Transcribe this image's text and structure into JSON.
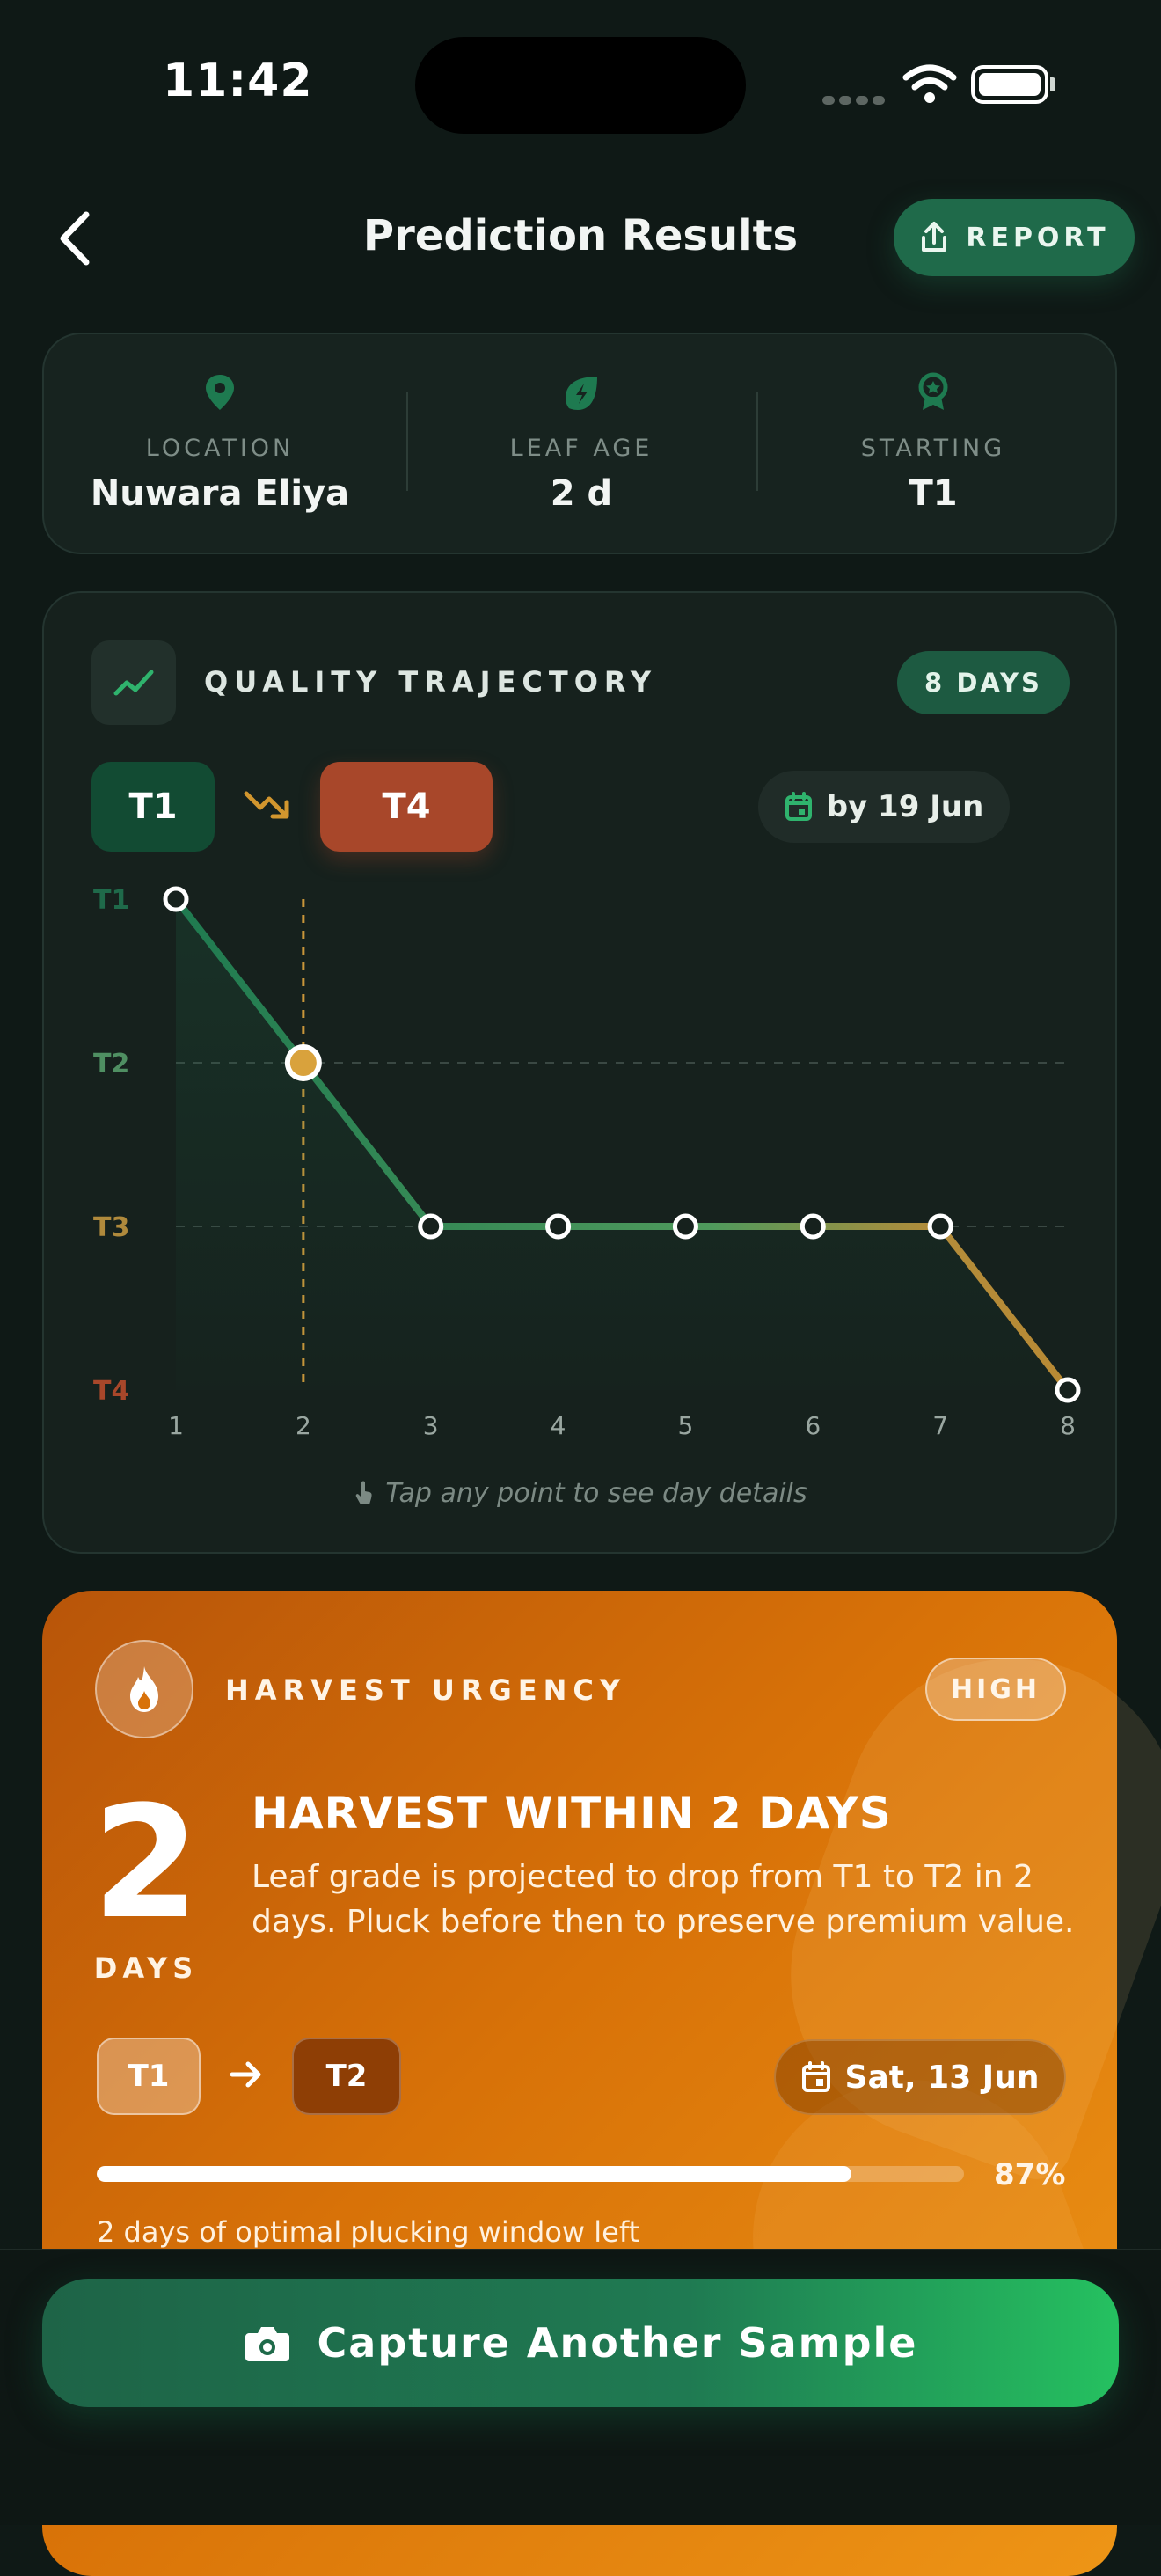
{
  "status_bar": {
    "time": "11:42"
  },
  "header": {
    "title": "Prediction Results",
    "report_label": "REPORT"
  },
  "info": [
    {
      "icon": "location-pin-icon",
      "label": "LOCATION",
      "value": "Nuwara Eliya"
    },
    {
      "icon": "leaf-bolt-icon",
      "label": "LEAF AGE",
      "value": "2 d"
    },
    {
      "icon": "award-badge-icon",
      "label": "STARTING",
      "value": "T1"
    }
  ],
  "trajectory": {
    "label": "QUALITY TRAJECTORY",
    "days_badge": "8 DAYS",
    "from_grade": "T1",
    "to_grade": "T4",
    "by_date": "by 19 Jun",
    "tap_hint": "Tap any point to see day details"
  },
  "chart_data": {
    "type": "line",
    "x": [
      1,
      2,
      3,
      4,
      5,
      6,
      7,
      8
    ],
    "y_categories": [
      "T1",
      "T2",
      "T3",
      "T4"
    ],
    "values": [
      "T1",
      "T2",
      "T3",
      "T3",
      "T3",
      "T3",
      "T3",
      "T4"
    ],
    "selected_day": 2,
    "grid": true,
    "colors": {
      "T1": "#1f6a4a",
      "T2": "#4f8f62",
      "T3": "#b08a3c",
      "T4": "#a8472a"
    }
  },
  "urgency": {
    "label": "HARVEST URGENCY",
    "level": "HIGH",
    "days_number": "2",
    "days_label": "DAYS",
    "title": "HARVEST WITHIN 2 DAYS",
    "description": "Leaf grade is projected to drop from T1 to T2 in 2 days. Pluck before then to preserve premium value.",
    "from_grade": "T1",
    "to_grade": "T2",
    "date": "Sat, 13 Jun",
    "progress_percent": 87,
    "progress_label": "87%",
    "footer": "2 days of optimal plucking window left"
  },
  "capture_button": {
    "label": "Capture Another Sample"
  }
}
